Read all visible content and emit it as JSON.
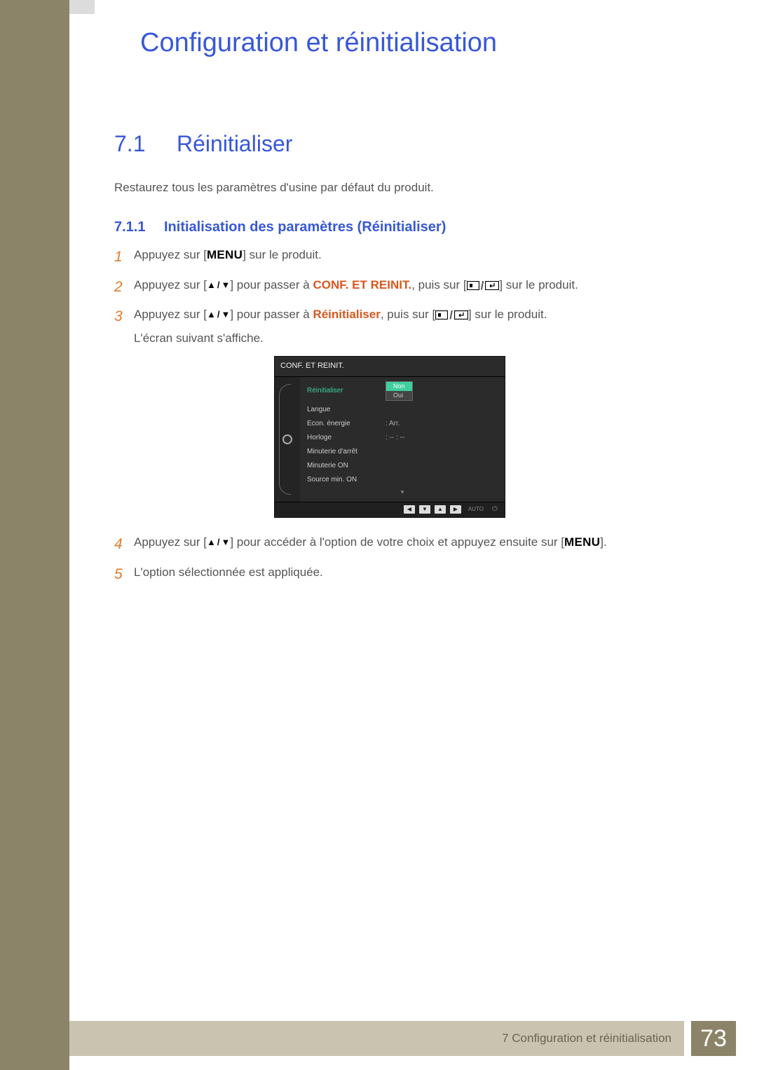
{
  "page": {
    "title": "Configuration et réinitialisation",
    "section_number": "7.1",
    "section_title": "Réinitialiser",
    "section_desc": "Restaurez tous les paramètres d'usine par défaut du produit.",
    "subsection_number": "7.1.1",
    "subsection_title": "Initialisation des paramètres (Réinitialiser)"
  },
  "labels": {
    "menu": "MENU",
    "appuyez_sur": "Appuyez sur [",
    "sur_le_produit": "] sur le produit.",
    "pour_passer_a": "] pour passer à ",
    "puis_sur": ", puis sur [",
    "conf_et_reinit": "CONF. ET REINIT.",
    "reinitialiser": "Réinitialiser",
    "ecran_suivant": "L'écran suivant s'affiche.",
    "step4_a": "] pour accéder à l'option de votre choix et appuyez ensuite sur [",
    "step4_b": "].",
    "step5": "L'option sélectionnée est appliquée."
  },
  "steps": [
    "1",
    "2",
    "3",
    "4",
    "5"
  ],
  "osd": {
    "title": "CONF. ET REINIT.",
    "items": [
      {
        "label": "Réinitialiser",
        "value": ""
      },
      {
        "label": "Langue",
        "value": ""
      },
      {
        "label": "Econ. énergie",
        "value": ":  Arr."
      },
      {
        "label": "Horloge",
        "value": ":  -- : --"
      },
      {
        "label": "Minuterie d'arrêt",
        "value": ""
      },
      {
        "label": "Minuterie ON",
        "value": ""
      },
      {
        "label": "Source min. ON",
        "value": ""
      }
    ],
    "popup": {
      "option1": "Non",
      "option2": "Oui"
    },
    "footer_auto": "AUTO"
  },
  "footer": {
    "text": "7  Configuration et réinitialisation",
    "page_number": "73"
  }
}
